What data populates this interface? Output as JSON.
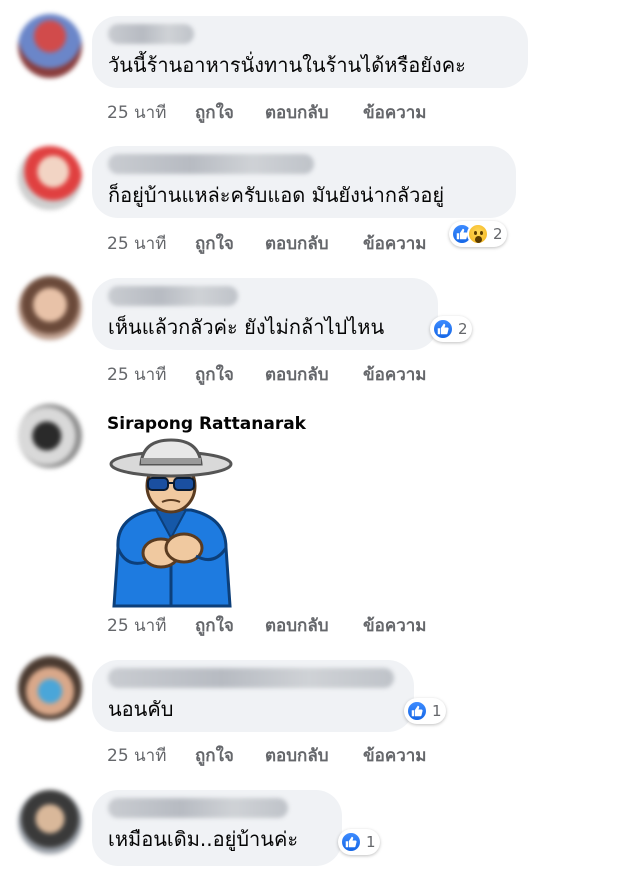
{
  "comments": [
    {
      "text": "วันนี้ร้านอาหารนั่งทานในร้านได้หรือยังคะ",
      "time": "25 นาที",
      "like": "ถูกใจ",
      "reply": "ตอบกลับ",
      "message": "ข้อความ"
    },
    {
      "text": "ก็อยู่บ้านแหล่ะครับแอด มันยังน่ากลัวอยู่",
      "time": "25 นาที",
      "like": "ถูกใจ",
      "reply": "ตอบกลับ",
      "message": "ข้อความ",
      "reaction_count": "2",
      "reactions": [
        "like-icon",
        "wow-icon"
      ]
    },
    {
      "text": "เห็นแล้วกลัวค่ะ ยังไม่กล้าไปไหน",
      "time": "25 นาที",
      "like": "ถูกใจ",
      "reply": "ตอบกลับ",
      "message": "ข้อความ",
      "reaction_count": "2",
      "reactions": [
        "like-icon"
      ]
    },
    {
      "author": "Sirapong Rattanarak",
      "sticker": "old-man-clapping-sticker",
      "time": "25 นาที",
      "like": "ถูกใจ",
      "reply": "ตอบกลับ",
      "message": "ข้อความ"
    },
    {
      "text": "นอนคับ",
      "time": "25 นาที",
      "like": "ถูกใจ",
      "reply": "ตอบกลับ",
      "message": "ข้อความ",
      "reaction_count": "1",
      "reactions": [
        "like-icon"
      ]
    },
    {
      "text": "เหมือนเดิม..อยู่บ้านค่ะ",
      "reaction_count": "1",
      "reactions": [
        "like-icon"
      ]
    }
  ],
  "colors": {
    "bubble": "#f0f2f5",
    "meta_text": "#65676b",
    "like_blue": "#1877f2"
  }
}
